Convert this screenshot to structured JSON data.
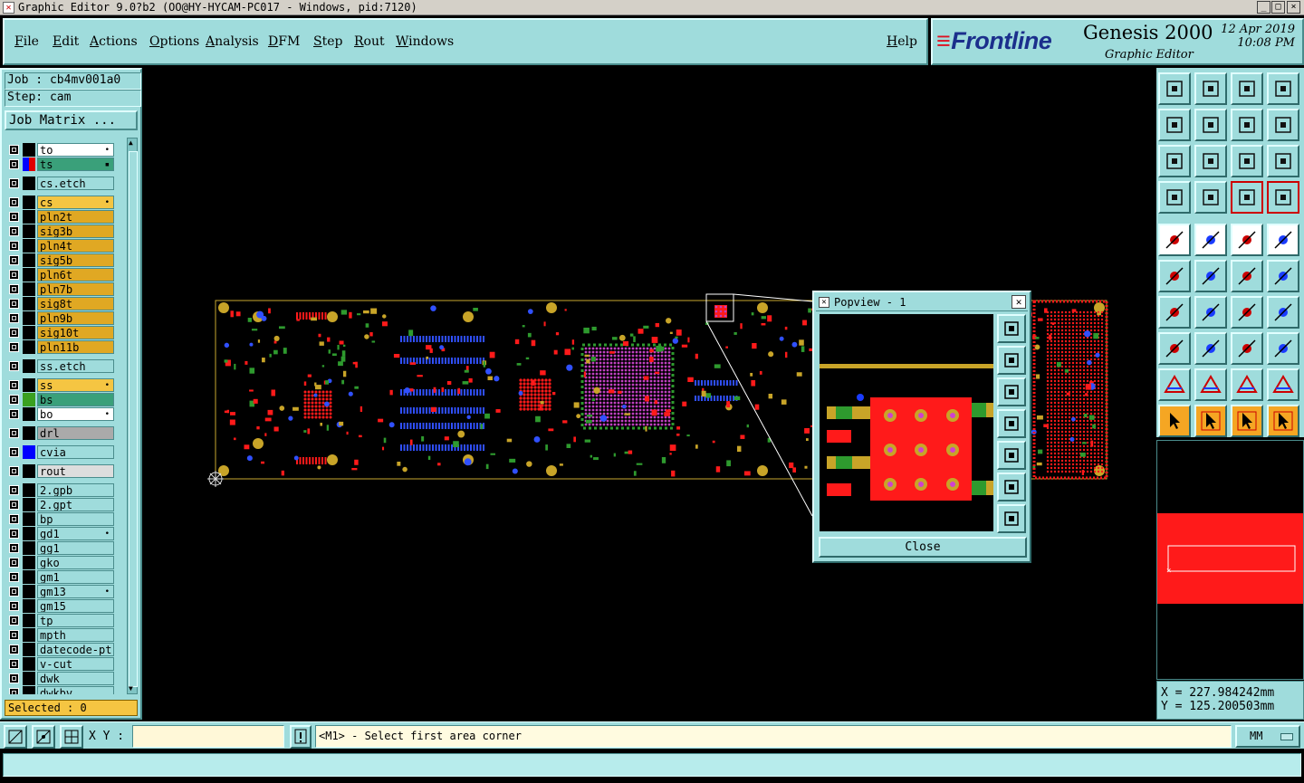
{
  "window": {
    "title": "Graphic Editor 9.0?b2 (OO@HY-HYCAM-PC017 - Windows, pid:7120)",
    "controls": [
      "_",
      "□",
      "×"
    ]
  },
  "menu": {
    "items": [
      "File",
      "Edit",
      "Actions",
      "Options",
      "Analysis",
      "DFM",
      "Step",
      "Rout",
      "Windows"
    ],
    "help": "Help"
  },
  "brand": {
    "logo": "Frontline",
    "product": "Genesis 2000",
    "subtitle": "Graphic Editor",
    "date": "12 Apr 2019",
    "time": "10:08 PM"
  },
  "job": {
    "job_label": "Job : cb4mv001a0",
    "step_label": "Step: cam",
    "matrix_button": "Job Matrix ..."
  },
  "layers": [
    {
      "name": "to",
      "bg": "#ffffff",
      "swatch": "#000000",
      "flag": "•"
    },
    {
      "name": "ts",
      "bg": "#3aa07a",
      "swatch": "#e00000",
      "flag": "▪",
      "swatch2": "#0000ff"
    },
    {
      "name": "cs.etch",
      "bg": "#9fdcdc",
      "swatch": "#000000",
      "gap": true
    },
    {
      "name": "cs",
      "bg": "#f5c542",
      "swatch": "#000000",
      "flag": "•",
      "gap": true
    },
    {
      "name": "pln2t",
      "bg": "#e0a823",
      "swatch": "#000000"
    },
    {
      "name": "sig3b",
      "bg": "#e0a823",
      "swatch": "#000000"
    },
    {
      "name": "pln4t",
      "bg": "#e0a823",
      "swatch": "#000000"
    },
    {
      "name": "sig5b",
      "bg": "#e0a823",
      "swatch": "#000000"
    },
    {
      "name": "pln6t",
      "bg": "#e0a823",
      "swatch": "#000000"
    },
    {
      "name": "pln7b",
      "bg": "#e0a823",
      "swatch": "#000000"
    },
    {
      "name": "sig8t",
      "bg": "#e0a823",
      "swatch": "#000000"
    },
    {
      "name": "pln9b",
      "bg": "#e0a823",
      "swatch": "#000000"
    },
    {
      "name": "sig10t",
      "bg": "#e0a823",
      "swatch": "#000000"
    },
    {
      "name": "pln11b",
      "bg": "#e0a823",
      "swatch": "#000000"
    },
    {
      "name": "ss.etch",
      "bg": "#9fdcdc",
      "swatch": "#000000",
      "gap": true
    },
    {
      "name": "ss",
      "bg": "#f5c542",
      "swatch": "#000000",
      "flag": "•",
      "gap": true
    },
    {
      "name": "bs",
      "bg": "#3aa07a",
      "swatch": "#3aa020"
    },
    {
      "name": "bo",
      "bg": "#ffffff",
      "swatch": "#000000",
      "flag": "•"
    },
    {
      "name": "drl",
      "bg": "#aaaaaa",
      "swatch": "#000000",
      "gap": true
    },
    {
      "name": "cvia",
      "bg": "#9fdcdc",
      "swatch": "#0000ff",
      "gap": true
    },
    {
      "name": "rout",
      "bg": "#dddddd",
      "swatch": "#000000",
      "gap": true
    },
    {
      "name": "2.gpb",
      "bg": "#9fdcdc",
      "swatch": "#000000",
      "gap": true
    },
    {
      "name": "2.gpt",
      "bg": "#9fdcdc",
      "swatch": "#000000"
    },
    {
      "name": "bp",
      "bg": "#9fdcdc",
      "swatch": "#000000"
    },
    {
      "name": "gd1",
      "bg": "#9fdcdc",
      "swatch": "#000000",
      "flag": "•"
    },
    {
      "name": "gg1",
      "bg": "#9fdcdc",
      "swatch": "#000000"
    },
    {
      "name": "gko",
      "bg": "#9fdcdc",
      "swatch": "#000000"
    },
    {
      "name": "gm1",
      "bg": "#9fdcdc",
      "swatch": "#000000"
    },
    {
      "name": "gm13",
      "bg": "#9fdcdc",
      "swatch": "#000000",
      "flag": "•"
    },
    {
      "name": "gm15",
      "bg": "#9fdcdc",
      "swatch": "#000000"
    },
    {
      "name": "tp",
      "bg": "#9fdcdc",
      "swatch": "#000000"
    },
    {
      "name": "mpth",
      "bg": "#9fdcdc",
      "swatch": "#000000"
    },
    {
      "name": "datecode-pt",
      "bg": "#9fdcdc",
      "swatch": "#000000"
    },
    {
      "name": "v-cut",
      "bg": "#9fdcdc",
      "swatch": "#000000"
    },
    {
      "name": "dwk",
      "bg": "#9fdcdc",
      "swatch": "#000000"
    },
    {
      "name": "dwkbv",
      "bg": "#9fdcdc",
      "swatch": "#000000"
    }
  ],
  "selected": "Selected : 0",
  "coords": {
    "x": "X = 227.984242mm",
    "y": "Y = 125.200503mm"
  },
  "popview": {
    "title": "Popview - 1",
    "close": "Close"
  },
  "bottom": {
    "xy_label": "X Y :",
    "xy_value": "",
    "message": "<M1> - Select first area corner",
    "units": "MM"
  },
  "colors": {
    "panel": "#9fdcdc",
    "board_outline": "#c8a830",
    "pad_red": "#ff1a1a",
    "pad_green": "#2e9a2e",
    "pad_gold": "#c8a428",
    "via_magenta": "#c040c0"
  },
  "icons": {
    "tools_row1": [
      "open-job-icon",
      "save-icon",
      "home-icon",
      "window-icon"
    ],
    "tools_row2": [
      "pan-left-icon",
      "pan-right-icon",
      "swap-icon",
      "route-icon"
    ],
    "tools_row3": [
      "zoom-fit-icon",
      "zoom-home-icon",
      "ratio-icon",
      "help-icon"
    ],
    "tools_row4": [
      "paint-icon",
      "grid-icon",
      "net-icon",
      "net-select-icon"
    ],
    "tools_row5": [
      "cursor-circle-icon",
      "measure-icon",
      "ruler-icon",
      "dot-icon"
    ],
    "tools_row6": [
      "connect-icon",
      "cross-icon",
      "line-dot-icon",
      "line-end-icon"
    ],
    "tools_row7": [
      "angle-icon",
      "diagonal-icon",
      "arc-icon",
      "symbol-icon"
    ],
    "tools_row8": [
      "pad-select-icon",
      "dash-icon",
      "box-icon",
      "shapes-icon"
    ],
    "tools_row9": [
      "triangle-icon",
      "triangle-a-icon",
      "triangle-b-icon",
      "triangle-c-icon"
    ],
    "tools_row10": [
      "pointer-icon",
      "pointer-box-icon",
      "pointer-select-icon",
      "pointer-net-icon"
    ]
  }
}
